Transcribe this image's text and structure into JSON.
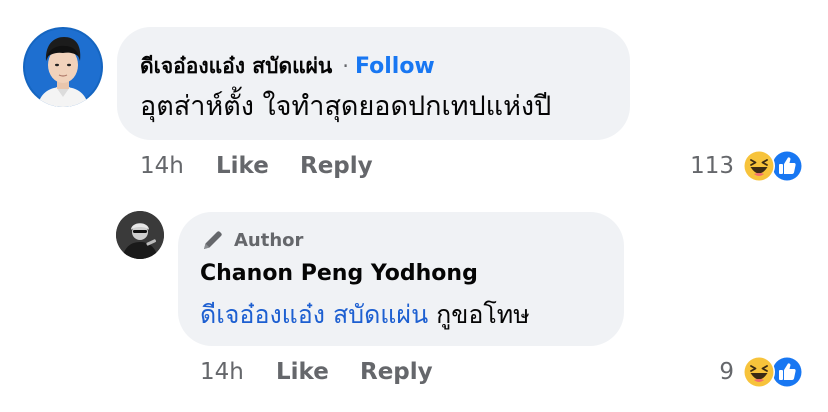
{
  "comment": {
    "author_name": "ดีเจอ๋องแอ๋ง สบัดแผ่น",
    "separator": "·",
    "follow_label": "Follow",
    "text": "อุตส่าห์ตั้ง ใจทำสุดยอดปกเทปแห่งปี",
    "time": "14h",
    "like_label": "Like",
    "reply_label": "Reply",
    "reaction_count": "113",
    "reaction_icons": [
      "haha-icon",
      "like-reaction-icon"
    ]
  },
  "reply": {
    "badge_label": "Author",
    "badge_icon": "pencil-icon",
    "author_name": "Chanon Peng Yodhong",
    "mention": "ดีเจอ๋องแอ๋ง สบัดแผ่น",
    "text": " กูขอโทษ",
    "time": "14h",
    "like_label": "Like",
    "reply_label": "Reply",
    "reaction_count": "9",
    "reaction_icons": [
      "haha-icon",
      "like-reaction-icon"
    ]
  },
  "colors": {
    "bubble": "#f0f2f5",
    "link_blue": "#1877f2",
    "mention_blue": "#1d5fd1",
    "secondary_text": "#65676b",
    "primary_text": "#050505",
    "like_blue": "#1877f2",
    "haha_yellow": "#f7c33b"
  }
}
